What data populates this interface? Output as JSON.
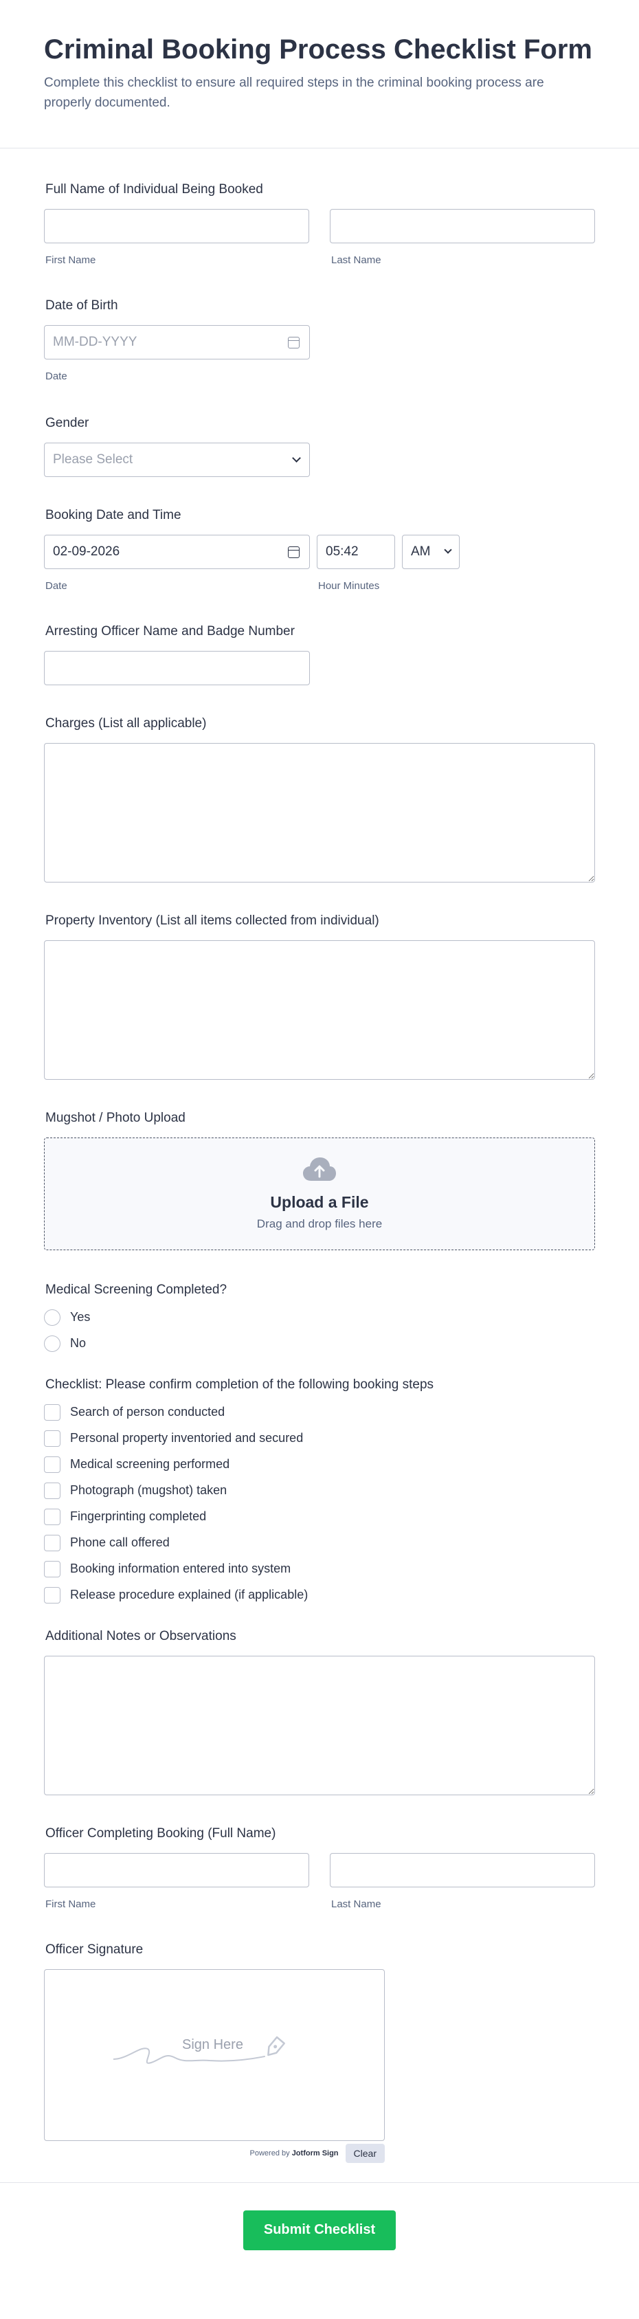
{
  "header": {
    "title": "Criminal Booking Process Checklist Form",
    "description": "Complete this checklist to ensure all required steps in the criminal booking process are properly documented."
  },
  "full_name": {
    "label": "Full Name of Individual Being Booked",
    "first_sub": "First Name",
    "last_sub": "Last Name"
  },
  "dob": {
    "label": "Date of Birth",
    "placeholder": "MM-DD-YYYY",
    "sub": "Date"
  },
  "gender": {
    "label": "Gender",
    "placeholder": "Please Select"
  },
  "booking": {
    "label": "Booking Date and Time",
    "date_value": "02-09-2026",
    "time_value": "05:42",
    "ampm": "AM",
    "date_sub": "Date",
    "time_sub": "Hour Minutes"
  },
  "officer_badge": {
    "label": "Arresting Officer Name and Badge Number"
  },
  "charges": {
    "label": "Charges (List all applicable)"
  },
  "property": {
    "label": "Property Inventory (List all items collected from individual)"
  },
  "mugshot": {
    "label": "Mugshot / Photo Upload",
    "title": "Upload a File",
    "hint": "Drag and drop files here"
  },
  "medical": {
    "label": "Medical Screening Completed?",
    "options": [
      "Yes",
      "No"
    ]
  },
  "checklist": {
    "label": "Checklist: Please confirm completion of the following booking steps",
    "items": [
      "Search of person conducted",
      "Personal property inventoried and secured",
      "Medical screening performed",
      "Photograph (mugshot) taken",
      "Fingerprinting completed",
      "Phone call offered",
      "Booking information entered into system",
      "Release procedure explained (if applicable)"
    ]
  },
  "notes": {
    "label": "Additional Notes or Observations"
  },
  "officer_completing": {
    "label": "Officer Completing Booking (Full Name)",
    "first_sub": "First Name",
    "last_sub": "Last Name"
  },
  "signature": {
    "label": "Officer Signature",
    "placeholder": "Sign Here",
    "powered_prefix": "Powered by",
    "powered_brand": "Jotform Sign",
    "clear_label": "Clear"
  },
  "submit_label": "Submit Checklist",
  "colors": {
    "submit": "#18bd5b",
    "text": "#2c3345",
    "muted": "#57647e",
    "border": "#b8bdc9"
  }
}
